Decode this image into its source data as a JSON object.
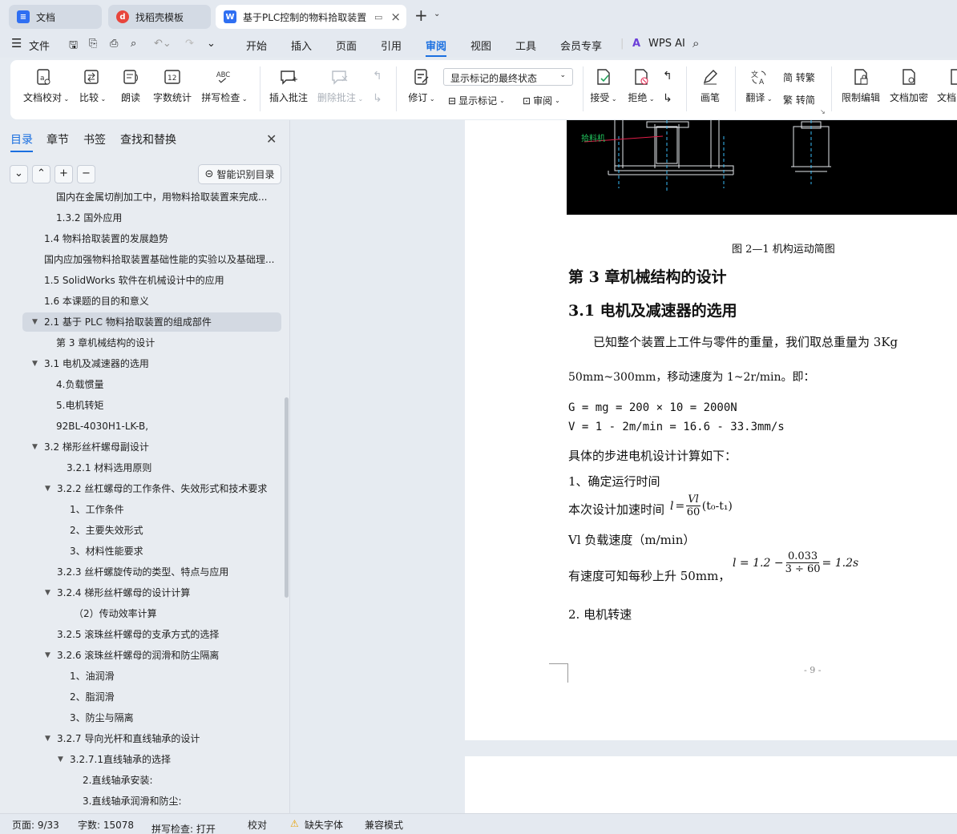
{
  "tabs": [
    {
      "label": "文档",
      "icon": "document-icon"
    },
    {
      "label": "找稻壳模板",
      "icon": "docer-icon"
    },
    {
      "label": "基于PLC控制的物料拾取装置",
      "icon": "wps-writer-icon",
      "close": "×"
    }
  ],
  "tab_add": "+",
  "menu": {
    "file": "文件",
    "items": [
      "开始",
      "插入",
      "页面",
      "引用",
      "审阅",
      "视图",
      "工具",
      "会员专享"
    ],
    "active": "审阅",
    "ai": "WPS AI"
  },
  "ribbon": {
    "proofread": "文档校对",
    "compare": "比较",
    "read_aloud": "朗读",
    "word_count": "字数统计",
    "word_count_icon": "12",
    "spell_check": "拼写检查",
    "spell_icon": "ABC",
    "insert_comment": "插入批注",
    "delete_comment": "删除批注",
    "track": "修订",
    "markup_state": "显示标记的最终状态",
    "show_markup": "显示标记",
    "review": "审阅",
    "accept": "接受",
    "reject": "拒绝",
    "pen": "画笔",
    "translate": "翻译",
    "trad": "简 转繁",
    "simp": "繁 转简",
    "restrict": "限制编辑",
    "encrypt": "文档加密",
    "more": "文档"
  },
  "sidebar": {
    "tabs": [
      "目录",
      "章节",
      "书签",
      "查找和替换"
    ],
    "active": "目录",
    "smart_toc": "智能识别目录",
    "toc": [
      {
        "text": "国内在金属切削加工中，用物料拾取装置来完成...",
        "indent": 70
      },
      {
        "text": "1.3.2  国外应用",
        "indent": 70
      },
      {
        "text": "1.4 物料拾取装置的发展趋势",
        "indent": 55
      },
      {
        "text": "国内应加强物料拾取装置基础性能的实验以及基础理...",
        "indent": 55
      },
      {
        "text": "1.5 SolidWorks 软件在机械设计中的应用",
        "indent": 55
      },
      {
        "text": "1.6 本课题的目的和意义",
        "indent": 55
      },
      {
        "text": "2.1 基于 PLC 物料拾取装置的组成部件",
        "indent": 55,
        "arrow": true,
        "selected": true
      },
      {
        "text": "第 3 章机械结构的设计",
        "indent": 70
      },
      {
        "text": "3.1 电机及减速器的选用",
        "indent": 55,
        "arrow": true
      },
      {
        "text": "4.负载惯量",
        "indent": 70
      },
      {
        "text": "5.电机转矩",
        "indent": 70
      },
      {
        "text": "92BL-4030H1-LK-B,",
        "indent": 70
      },
      {
        "text": "3.2 梯形丝杆螺母副设计",
        "indent": 55,
        "arrow": true
      },
      {
        "text": "3.2.1 材料选用原则",
        "indent": 83
      },
      {
        "text": "3.2.2 丝杠螺母的工作条件、失效形式和技术要求",
        "indent": 71,
        "arrow": true
      },
      {
        "text": "1、工作条件",
        "indent": 87
      },
      {
        "text": "2、主要失效形式",
        "indent": 87
      },
      {
        "text": "3、材料性能要求",
        "indent": 87
      },
      {
        "text": "3.2.3 丝杆螺旋传动的类型、特点与应用",
        "indent": 71
      },
      {
        "text": "3.2.4 梯形丝杆螺母的设计计算",
        "indent": 71,
        "arrow": true
      },
      {
        "text": "（2）传动效率计算",
        "indent": 92
      },
      {
        "text": "3.2.5 滚珠丝杆螺母的支承方式的选择",
        "indent": 71
      },
      {
        "text": "3.2.6 滚珠丝杆螺母的润滑和防尘隔离",
        "indent": 71,
        "arrow": true
      },
      {
        "text": "1、油润滑",
        "indent": 87
      },
      {
        "text": "2、脂润滑",
        "indent": 87
      },
      {
        "text": "3、防尘与隔离",
        "indent": 87
      },
      {
        "text": "3.2.7 导向光杆和直线轴承的设计",
        "indent": 71,
        "arrow": true
      },
      {
        "text": "3.2.7.1直线轴承的选择",
        "indent": 87,
        "arrow": true
      },
      {
        "text": "2.直线轴承安装:",
        "indent": 103
      },
      {
        "text": "3.直线轴承润滑和防尘:",
        "indent": 103
      }
    ]
  },
  "doc": {
    "cad_label": "拾料机",
    "figure_caption": "图 2—1   机构运动简图",
    "h_chapter": "第 3 章机械结构的设计",
    "h_section": "3.1 电机及减速器的选用",
    "p1": "已知整个装置上工件与零件的重量，我们取总重量为 3Kg",
    "p2": "50mm~300mm，移动速度为 1~2r/min。即：",
    "eq1": "G = mg = 200 × 10 = 2000N",
    "eq2": "V = 1 - 2m/min = 16.6 - 33.3mm/s",
    "p3": "具体的步进电机设计计算如下：",
    "p4": "1、确定运行时间",
    "p5": "本次设计加速时间",
    "f1_lhs": "l",
    "f1_num": "Vl",
    "f1_den": "60",
    "f1_tail": "(t₀-t₁)",
    "p6": "Vl 负载速度（m/min）",
    "p7": "有速度可知每秒上升 50mm，",
    "f2_pre": "l = 1.2 −",
    "f2_num": "0.033",
    "f2_den": "3 ÷ 60",
    "f2_post": "= 1.2s",
    "p8": "2. 电机转速",
    "page_num": "- 9 -"
  },
  "status": {
    "page": "页面: 9/33",
    "words": "字数: 15078",
    "spell": "拼写检查: 打开",
    "proof": "校对",
    "missing_font": "缺失字体",
    "compat": "兼容模式"
  },
  "colors": {
    "accent": "#1a6fe0",
    "wps_blue": "#2f6ff2",
    "docer_red": "#e8453c",
    "cad_bg": "#000000",
    "cad_green": "#22c55e",
    "cad_red": "#e11d48",
    "cad_white": "#e5e7eb",
    "cad_cyan": "#38bdf8"
  }
}
